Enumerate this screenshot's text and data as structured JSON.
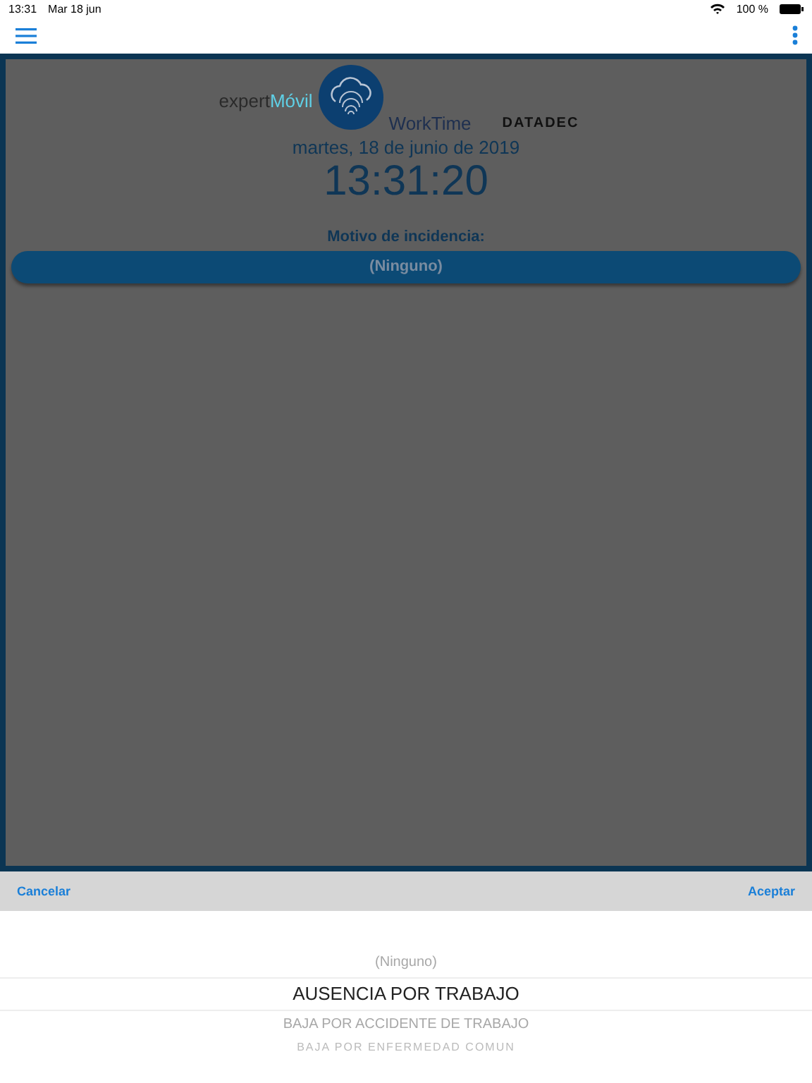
{
  "status_bar": {
    "time": "13:31",
    "date": "Mar 18 jun",
    "battery": "100 %"
  },
  "main": {
    "logo": {
      "prefix": "expert",
      "accent": "Móvil",
      "product": "WorkTime",
      "brand": "DATADEC"
    },
    "date": "martes, 18 de junio de 2019",
    "clock": "13:31:20",
    "reason_label": "Motivo de incidencia:",
    "reason_value": "(Ninguno)",
    "dimmed": true
  },
  "picker": {
    "cancel": "Cancelar",
    "accept": "Aceptar",
    "options": [
      {
        "label": "(Ninguno)",
        "selected": false
      },
      {
        "label": "AUSENCIA POR TRABAJO",
        "selected": true
      },
      {
        "label": "BAJA POR ACCIDENTE DE TRABAJO",
        "selected": false
      },
      {
        "label": "BAJA POR ENFERMEDAD COMUN",
        "selected": false
      }
    ]
  }
}
